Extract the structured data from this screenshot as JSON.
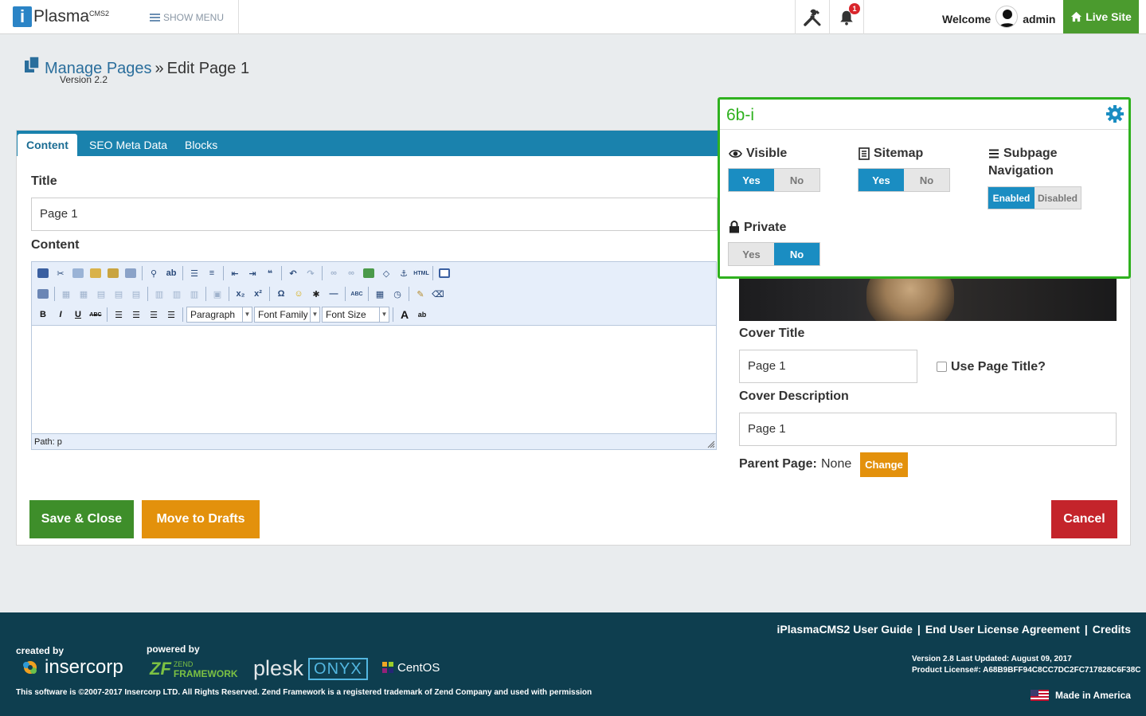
{
  "header": {
    "logo_text": "Plasma",
    "logo_sup": "CMS2",
    "logo_letter": "i",
    "show_menu": "SHOW MENU",
    "notification_count": "1",
    "welcome": "Welcome",
    "username": "admin",
    "live_site": "Live Site"
  },
  "breadcrumb": {
    "section": "Manage Pages",
    "separator": "»",
    "current": "Edit Page 1",
    "version": "Version 2.2"
  },
  "tabs": [
    {
      "label": "Content",
      "active": true
    },
    {
      "label": "SEO Meta Data",
      "active": false
    },
    {
      "label": "Blocks",
      "active": false
    }
  ],
  "form": {
    "title_label": "Title",
    "title_value": "Page 1",
    "content_label": "Content",
    "cover_title_label": "Cover Title",
    "cover_title_value": "Page 1",
    "use_page_title_label": "Use Page Title?",
    "cover_description_label": "Cover Description",
    "cover_description_value": "Page 1",
    "parent_page_label": "Parent Page:",
    "parent_page_value": "None",
    "change_button": "Change"
  },
  "editor": {
    "format_select": "Paragraph",
    "font_family_select": "Font Family",
    "font_size_select": "Font Size",
    "path": "Path: p"
  },
  "actions": {
    "save_close": "Save & Close",
    "move_drafts": "Move to Drafts",
    "cancel": "Cancel"
  },
  "settings": {
    "title": "6b-i",
    "visible_label": "Visible",
    "sitemap_label": "Sitemap",
    "subpage_label_1": "Subpage",
    "subpage_label_2": "Navigation",
    "private_label": "Private",
    "yes": "Yes",
    "no": "No",
    "enabled": "Enabled",
    "disabled": "Disabled",
    "visible_value": "Yes",
    "sitemap_value": "Yes",
    "subpage_value": "Enabled",
    "private_value": "No"
  },
  "footer": {
    "links": [
      "iPlasmaCMS2 User Guide",
      "|",
      "End User License Agreement",
      "|",
      "Credits"
    ],
    "created_by": "created by",
    "powered_by": "powered by",
    "insercorp": "insercorp",
    "zend_top": "ZEND",
    "zend_bottom": "FRAMEWORK",
    "plesk": "plesk",
    "onyx": "ONYX",
    "centos": "CentOS",
    "version_line": "Version 2.8 Last Updated: August 09, 2017",
    "license_line": "Product License#: A68B9BFF94C8CC7DC2FC717828C6F38C",
    "copyright": "This software is ©2007-2017 Insercorp LTD. All Rights Reserved. Zend Framework is a registered trademark of Zend Company and used with permission",
    "made_in": "Made in America"
  },
  "colors": {
    "accent_blue": "#1a82ad",
    "green": "#4b9b2e",
    "orange": "#e3910c",
    "red": "#c4242b",
    "highlight_green": "#2fb11f",
    "footer_bg": "#0e3e4f"
  }
}
